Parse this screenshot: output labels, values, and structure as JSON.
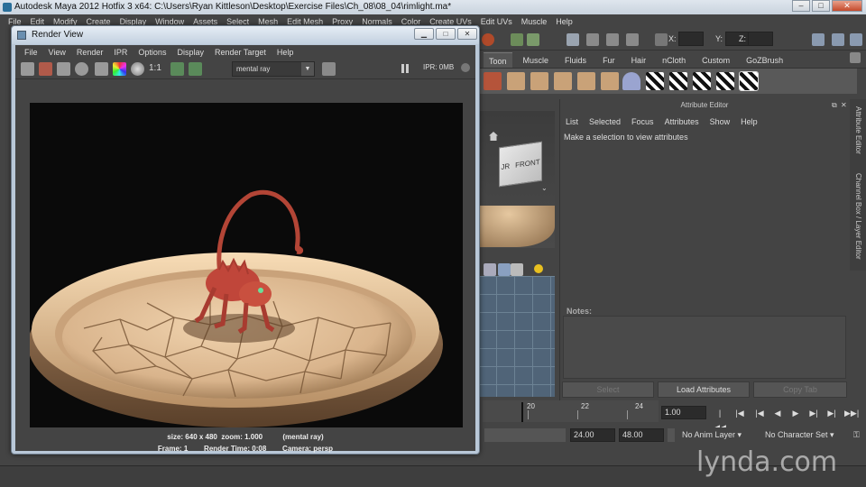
{
  "maya": {
    "title": "Autodesk Maya 2012 Hotfix 3 x64: C:\\Users\\Ryan Kittleson\\Desktop\\Exercise Files\\Ch_08\\08_04\\rimlight.ma*",
    "menu": [
      "File",
      "Edit",
      "Modify",
      "Create",
      "Display",
      "Window",
      "Assets",
      "Select",
      "Mesh",
      "Edit Mesh",
      "Proxy",
      "Normals",
      "Color",
      "Create UVs",
      "Edit UVs",
      "Muscle",
      "Help"
    ],
    "coords": {
      "x_label": "X:",
      "y_label": "Y:",
      "z_label": "Z:"
    },
    "shelf_tabs": [
      "Toon",
      "Muscle",
      "Fluids",
      "Fur",
      "Hair",
      "nCloth",
      "Custom",
      "GoZBrush"
    ],
    "active_shelf_tab": "Toon"
  },
  "attribute_editor": {
    "title": "Attribute Editor",
    "menu": [
      "List",
      "Selected",
      "Focus",
      "Attributes",
      "Show",
      "Help"
    ],
    "message": "Make a selection to view attributes",
    "notes_label": "Notes:",
    "buttons": {
      "select": "Select",
      "load": "Load Attributes",
      "copy": "Copy Tab"
    },
    "side_tabs": {
      "attr": "Attribute Editor",
      "channel": "Channel Box / Layer Editor"
    }
  },
  "viewcube": {
    "front": "FRONT",
    "right": "JR"
  },
  "timeline": {
    "ticks": [
      "20",
      "22",
      "24"
    ],
    "current_time": "1.00",
    "range_start": "24.00",
    "range_end": "48.00",
    "anim_layer": "No Anim Layer",
    "character_set": "No Character Set"
  },
  "render_view": {
    "title": "Render View",
    "menu": [
      "File",
      "View",
      "Render",
      "IPR",
      "Options",
      "Display",
      "Render Target",
      "Help"
    ],
    "renderer": "mental ray",
    "ratio_label": "1:1",
    "ipr_label": "IPR: 0MB",
    "info_line1": "size: 640 x 480  zoom: 1.000          (mental ray)",
    "info_line2": "Frame: 1        Render Time: 0:08        Camera: persp"
  },
  "watermark": "lynda.com",
  "colors": {
    "accent": "#4a4a4a",
    "window_chrome": "#c2d0df",
    "dish": "#d9b48c",
    "creature": "#c0463a"
  }
}
